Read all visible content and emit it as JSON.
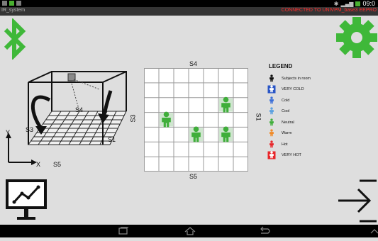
{
  "status_bar": {
    "time": "09:0"
  },
  "app": {
    "title": "IR_system",
    "connection_status": "CONNECTED TO UNIVPM_base3 EEPRO"
  },
  "colors": {
    "accent_green": "#3fb839",
    "grid_line": "#9a9a9a",
    "neutral": "#3fae3a",
    "status_red": "#ff2d2d"
  },
  "left_diagram": {
    "labels": {
      "s3": "S3",
      "s4": "S4",
      "s1": "S1",
      "s5": "S5",
      "x": "X",
      "y": "Y"
    }
  },
  "room_grid": {
    "rows": 7,
    "cols": 7,
    "labels": {
      "top": "S4",
      "bottom": "S5",
      "left": "S3",
      "right": "S1"
    },
    "occupants": [
      {
        "row": 2,
        "col": 5,
        "status": "Neutral"
      },
      {
        "row": 3,
        "col": 1,
        "status": "Neutral"
      },
      {
        "row": 4,
        "col": 3,
        "status": "Neutral"
      },
      {
        "row": 4,
        "col": 5,
        "status": "Neutral"
      }
    ]
  },
  "legend": {
    "title": "LEGEND",
    "items": [
      {
        "label": "Subjects in room",
        "icon": "person-icon",
        "color": "#111111",
        "boxed": false
      },
      {
        "label": "VERY COLD",
        "icon": "person-icon",
        "color": "#2a56c6",
        "boxed": true
      },
      {
        "label": "Cold",
        "icon": "person-icon",
        "color": "#3b6fd8",
        "boxed": false
      },
      {
        "label": "Cool",
        "icon": "person-icon",
        "color": "#5aa0e0",
        "boxed": false
      },
      {
        "label": "Neutral",
        "icon": "person-icon",
        "color": "#3fae3a",
        "boxed": false
      },
      {
        "label": "Warm",
        "icon": "person-icon",
        "color": "#f08a28",
        "boxed": false
      },
      {
        "label": "Hot",
        "icon": "person-icon",
        "color": "#e8262a",
        "boxed": false
      },
      {
        "label": "VERY HOT",
        "icon": "person-icon",
        "color": "#e8262a",
        "boxed": true
      }
    ]
  },
  "controls": {
    "bluetooth": "bluetooth-icon",
    "settings": "gear-icon",
    "chart": "chart-icon",
    "exit": "exit-arrow-icon"
  }
}
